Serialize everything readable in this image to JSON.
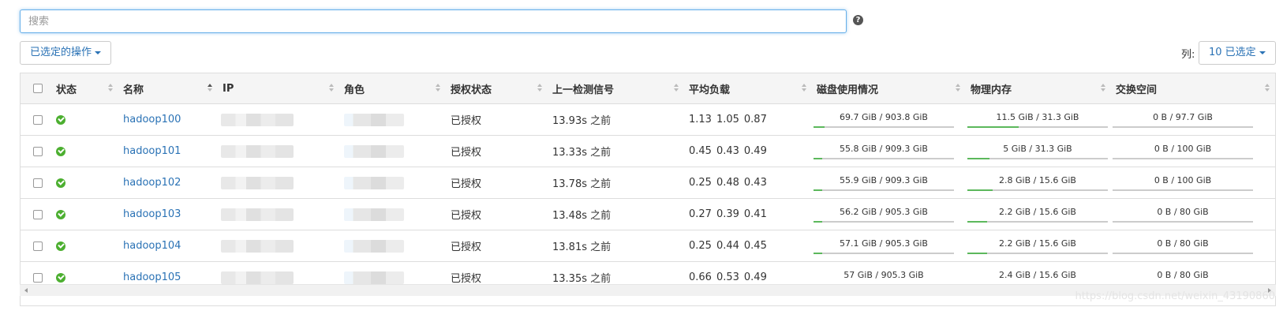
{
  "search": {
    "placeholder": "搜索"
  },
  "help_icon": "question-circle-icon",
  "toolbar": {
    "actions_label": "已选定的操作",
    "columns_label": "列:",
    "columns_button": "10 已选定"
  },
  "table": {
    "headers": [
      "状态",
      "名称",
      "IP",
      "角色",
      "授权状态",
      "上一检测信号",
      "平均负载",
      "磁盘使用情况",
      "物理内存",
      "交换空间"
    ],
    "rows": [
      {
        "name": "hadoop100",
        "auth": "已授权",
        "heartbeat": "13.93s 之前",
        "load": [
          "1.13",
          "1.05",
          "0.87"
        ],
        "disk": "69.7 GiB / 903.8 GiB",
        "disk_pct": 7.7,
        "mem": "11.5 GiB / 31.3 GiB",
        "mem_pct": 36.7,
        "swap": "0 B / 97.7 GiB",
        "swap_pct": 0
      },
      {
        "name": "hadoop101",
        "auth": "已授权",
        "heartbeat": "13.33s 之前",
        "load": [
          "0.45",
          "0.43",
          "0.49"
        ],
        "disk": "55.8 GiB / 909.3 GiB",
        "disk_pct": 6.1,
        "mem": "5 GiB / 31.3 GiB",
        "mem_pct": 16.0,
        "swap": "0 B / 100 GiB",
        "swap_pct": 0
      },
      {
        "name": "hadoop102",
        "auth": "已授权",
        "heartbeat": "13.78s 之前",
        "load": [
          "0.25",
          "0.48",
          "0.43"
        ],
        "disk": "55.9 GiB / 909.3 GiB",
        "disk_pct": 6.1,
        "mem": "2.8 GiB / 15.6 GiB",
        "mem_pct": 17.9,
        "swap": "0 B / 100 GiB",
        "swap_pct": 0
      },
      {
        "name": "hadoop103",
        "auth": "已授权",
        "heartbeat": "13.48s 之前",
        "load": [
          "0.27",
          "0.39",
          "0.41"
        ],
        "disk": "56.2 GiB / 905.3 GiB",
        "disk_pct": 6.2,
        "mem": "2.2 GiB / 15.6 GiB",
        "mem_pct": 14.1,
        "swap": "0 B / 80 GiB",
        "swap_pct": 0
      },
      {
        "name": "hadoop104",
        "auth": "已授权",
        "heartbeat": "13.81s 之前",
        "load": [
          "0.25",
          "0.44",
          "0.45"
        ],
        "disk": "57.1 GiB / 905.3 GiB",
        "disk_pct": 6.3,
        "mem": "2.2 GiB / 15.6 GiB",
        "mem_pct": 14.1,
        "swap": "0 B / 80 GiB",
        "swap_pct": 0
      },
      {
        "name": "hadoop105",
        "auth": "已授权",
        "heartbeat": "13.35s 之前",
        "load": [
          "0.66",
          "0.53",
          "0.49"
        ],
        "disk": "57 GiB / 905.3 GiB",
        "disk_pct": 6.3,
        "mem": "2.4 GiB / 15.6 GiB",
        "mem_pct": 15.4,
        "swap": "0 B / 80 GiB",
        "swap_pct": 0
      }
    ]
  },
  "colors": {
    "link": "#2a72b5",
    "ok": "#4caf30",
    "meter_fill": "#5cb85c"
  },
  "watermark": "https://blog.csdn.net/weixin_43190860"
}
